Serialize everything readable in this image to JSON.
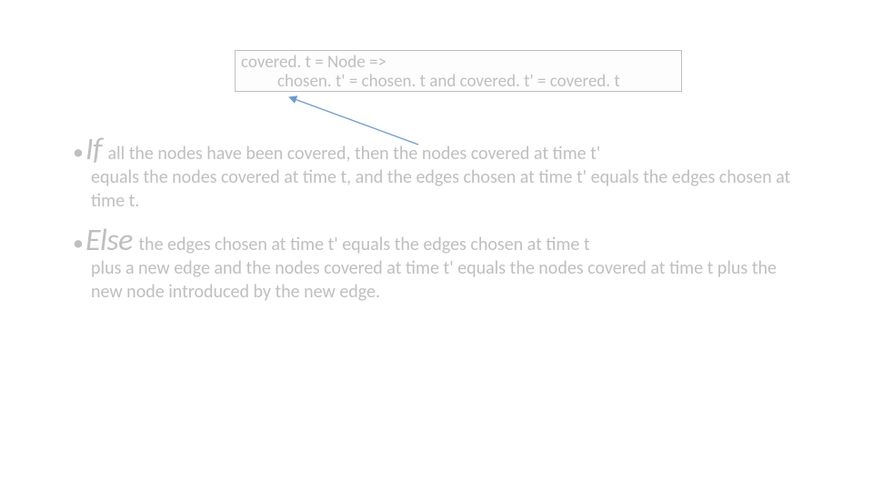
{
  "code": {
    "line1": "covered. t = Node =>",
    "line2": "chosen. t' = chosen. t and covered. t' = covered. t"
  },
  "bullets": {
    "if_kw": "If",
    "if_first": "all the nodes have been covered, then the nodes covered at time t'",
    "if_cont": "equals the nodes covered at time t, and the edges chosen at time t' equals the edges chosen at time t.",
    "else_kw": "Else",
    "else_first": "the edges chosen at time t' equals the edges chosen at time t",
    "else_cont": "plus a new edge and the nodes covered at time t' equals the nodes covered at time t plus the new node introduced by the new edge."
  }
}
